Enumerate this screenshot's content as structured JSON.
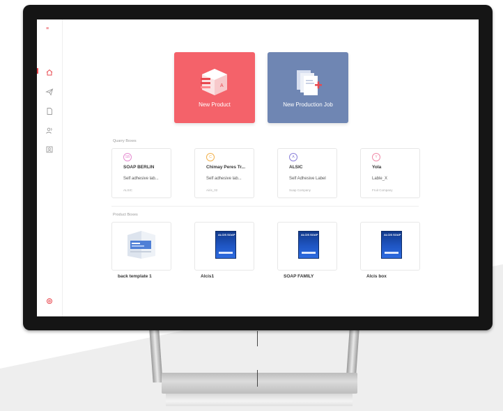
{
  "app": {
    "logo_text": "≡"
  },
  "sidebar": {
    "items": [
      {
        "icon": "home-icon",
        "active": true
      },
      {
        "icon": "send-icon",
        "active": false
      },
      {
        "icon": "document-icon",
        "active": false
      },
      {
        "icon": "users-icon",
        "active": false
      },
      {
        "icon": "user-badge-icon",
        "active": false
      }
    ],
    "bottom_icon": "settings-icon"
  },
  "actions": {
    "new_product": {
      "label": "New Product",
      "color": "#f4626a",
      "icon": "product-box-icon"
    },
    "new_production_job": {
      "label": "New Production Job",
      "color": "#6f86b3",
      "icon": "production-doc-icon"
    }
  },
  "quarry_boxes": {
    "label": "Quarry Boxes",
    "items": [
      {
        "badge": "SB",
        "badge_color": "#e58ad0",
        "title": "SOAP BERLIN",
        "subtitle": "Self adhesive lab...",
        "footer": "ALSIC"
      },
      {
        "badge": "C",
        "badge_color": "#f2b14b",
        "title": "Chimay Peres Tr...",
        "subtitle": "Self adhesive lab...",
        "footer": "Airis_02"
      },
      {
        "badge": "A",
        "badge_color": "#8a80d9",
        "title": "ALSIC",
        "subtitle": "Self Adhesive Label",
        "footer": "Soap Company"
      },
      {
        "badge": "Y",
        "badge_color": "#f08aa8",
        "title": "Yola",
        "subtitle": "Lable_X",
        "footer": "Fruit Company"
      }
    ]
  },
  "product_boxes": {
    "label": "Product Boxes",
    "items": [
      {
        "name": "back template 1",
        "thumb": "template-thumbnail"
      },
      {
        "name": "Alcis1",
        "thumb": "blue-box-thumbnail"
      },
      {
        "name": "SOAP FAMILY",
        "thumb": "blue-box-thumbnail"
      },
      {
        "name": "Alcis box",
        "thumb": "blue-box-thumbnail"
      }
    ],
    "thumb_text": "ALCIS SOAP"
  }
}
